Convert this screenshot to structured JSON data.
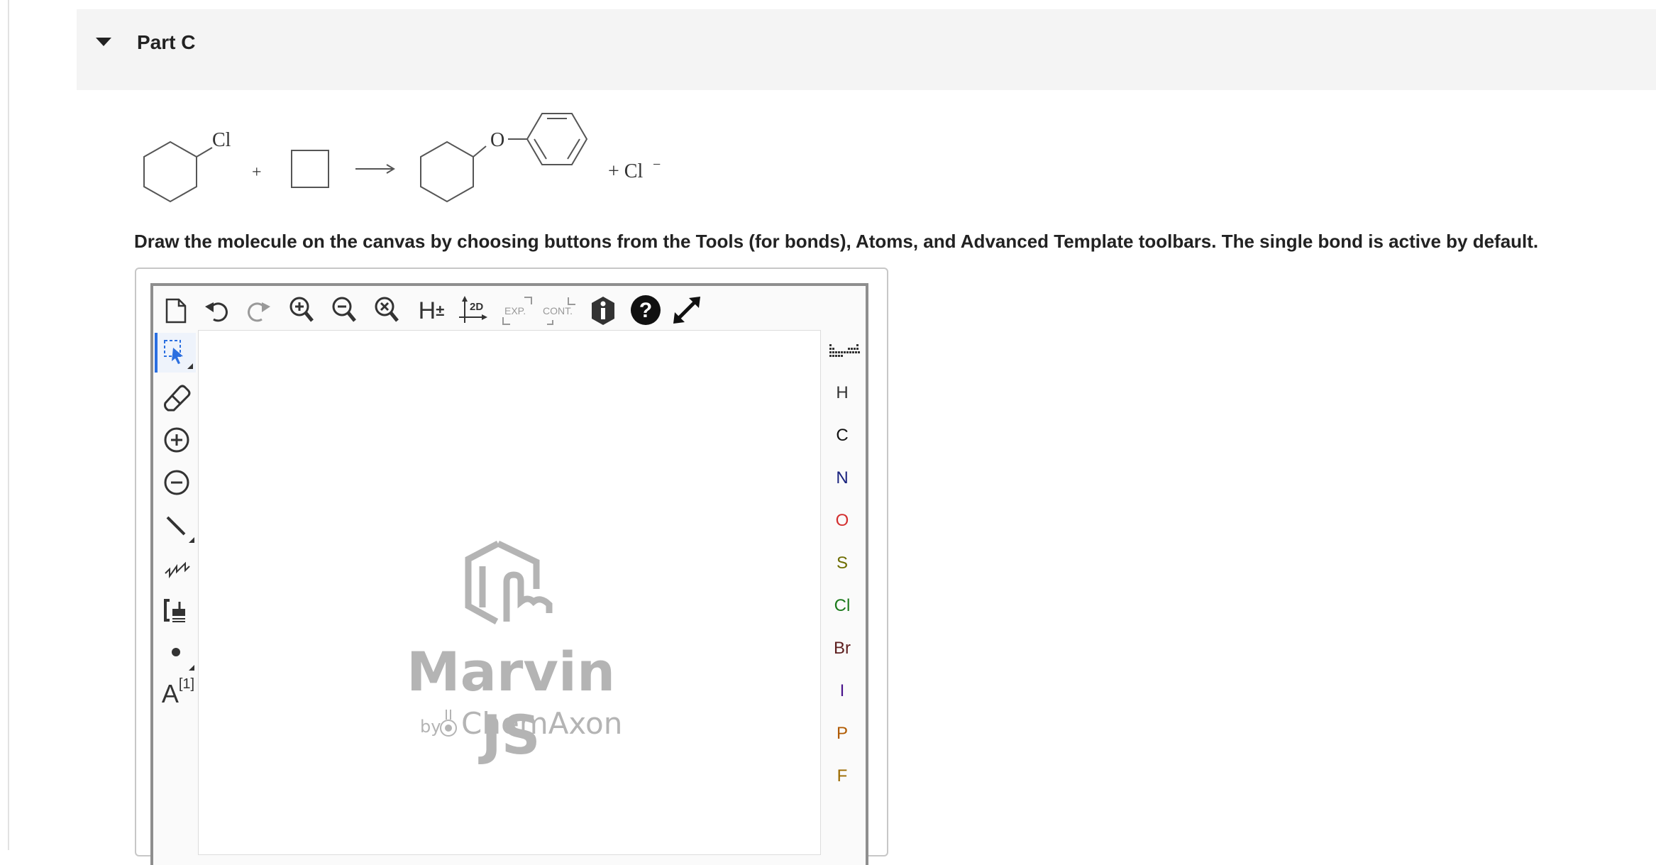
{
  "part": {
    "title": "Part C"
  },
  "reaction": {
    "reactant_substituent": "Cl",
    "plus_1": "+",
    "linker_atom": "O",
    "plus_2": "+ Cl",
    "charge": "−"
  },
  "instructions": "Draw the molecule on the canvas by choosing buttons from the Tools (for bonds), Atoms, and Advanced Template toolbars. The single bond is active by default.",
  "toolbar": {
    "h_label": "H",
    "h_sign": "±",
    "clean2d_label": "2D",
    "expand_label": "EXP.",
    "contract_label": "CONT."
  },
  "left_tools": {
    "atom_map_letter": "A",
    "atom_map_index": "[1]"
  },
  "atoms": [
    {
      "symbol": "H",
      "color": "#333333"
    },
    {
      "symbol": "C",
      "color": "#111111"
    },
    {
      "symbol": "N",
      "color": "#1a237e"
    },
    {
      "symbol": "O",
      "color": "#d32f2f"
    },
    {
      "symbol": "S",
      "color": "#6d6d00"
    },
    {
      "symbol": "Cl",
      "color": "#1b7a1b"
    },
    {
      "symbol": "Br",
      "color": "#5d1f1f"
    },
    {
      "symbol": "I",
      "color": "#4a148c"
    },
    {
      "symbol": "P",
      "color": "#b05a00"
    },
    {
      "symbol": "F",
      "color": "#9c6b00"
    }
  ],
  "branding": {
    "product": "Marvin JS",
    "by": "by",
    "company": "ChemAxon"
  }
}
